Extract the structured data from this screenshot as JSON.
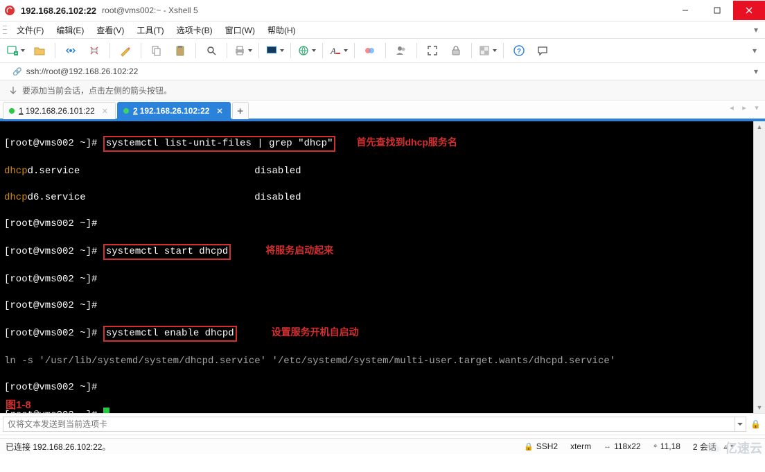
{
  "titlebar": {
    "title": "192.168.26.102:22",
    "subtitle": "root@vms002:~ - Xshell 5"
  },
  "menus": {
    "file": "文件(F)",
    "edit": "编辑(E)",
    "view": "查看(V)",
    "tools": "工具(T)",
    "tabs": "选项卡(B)",
    "window": "窗口(W)",
    "help": "帮助(H)"
  },
  "addressbar": {
    "url": "ssh://root@192.168.26.102:22"
  },
  "hintbar": {
    "text": "要添加当前会话，点击左侧的箭头按钮。"
  },
  "tabs": [
    {
      "num": "1",
      "label": "192.168.26.101:22",
      "active": false
    },
    {
      "num": "2",
      "label": "192.168.26.102:22",
      "active": true
    }
  ],
  "terminal": {
    "prompt": "[root@vms002 ~]#",
    "cmd1": "systemctl list-unit-files | grep \"dhcp\"",
    "ann1": "首先查找到dhcp服务名",
    "line_dhcpd_prefix": "dhcp",
    "line_dhcpd_suffix": "d.service",
    "line_dhcpd_state": "disabled",
    "line_dhcpd6_prefix": "dhcp",
    "line_dhcpd6_suffix": "d6.service",
    "line_dhcpd6_state": "disabled",
    "cmd2": "systemctl start dhcpd",
    "ann2": "将服务启动起来",
    "cmd3": "systemctl enable dhcpd",
    "ann3": "设置服务开机自启动",
    "ln_line": "ln -s '/usr/lib/systemd/system/dhcpd.service' '/etc/systemd/system/multi-user.target.wants/dhcpd.service'",
    "figure_label": "图1-8"
  },
  "inputbar": {
    "placeholder": "仅将文本发送到当前选项卡"
  },
  "statusbar": {
    "conn": "已连接 192.168.26.102:22。",
    "proto": "SSH2",
    "term": "xterm",
    "size": "118x22",
    "pos": "11,18",
    "sessions_label": "2 会话"
  },
  "watermark": "亿速云"
}
